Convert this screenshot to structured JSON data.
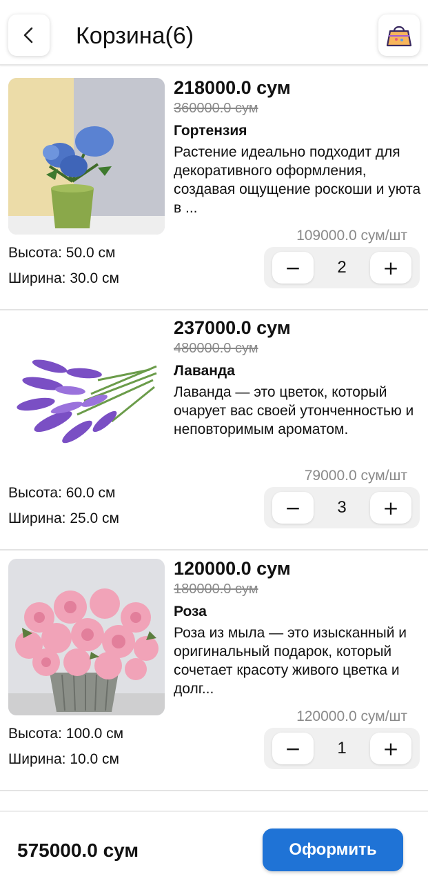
{
  "header": {
    "title": "Корзина(6)",
    "back_icon": "chevron-left-icon",
    "gift_icon": "gift-bag-icon"
  },
  "items": [
    {
      "price": "218000.0 сум",
      "old_price": "360000.0 сум",
      "name": "Гортензия",
      "description": "Растение идеально подходит для декоративного оформления, создавая ощущение роскоши и уюта в ...",
      "unit_price": "109000.0 сум/шт",
      "height": "Высота: 50.0 см",
      "width": "Ширина: 30.0 см",
      "quantity": "2",
      "minus": "−",
      "plus": "+"
    },
    {
      "price": "237000.0 сум",
      "old_price": "480000.0 сум",
      "name": "Лаванда",
      "description": "Лаванда — это цветок, который очарует вас своей утонченностью и неповторимым ароматом.",
      "unit_price": "79000.0 сум/шт",
      "height": "Высота: 60.0 см",
      "width": "Ширина: 25.0 см",
      "quantity": "3",
      "minus": "−",
      "plus": "+"
    },
    {
      "price": "120000.0 сум",
      "old_price": "180000.0 сум",
      "name": "Роза",
      "description": "Роза из мыла — это изысканный и оригинальный подарок, который сочетает красоту живого цветка и долг...",
      "unit_price": "120000.0 сум/шт",
      "height": "Высота: 100.0 см",
      "width": "Ширина: 10.0 см",
      "quantity": "1",
      "minus": "−",
      "plus": "+"
    }
  ],
  "footer": {
    "total": "575000.0 сум",
    "checkout_label": "Оформить"
  },
  "colors": {
    "accent": "#1f73d6",
    "muted_text": "#8a8a8a",
    "stepper_bg": "#f0f0f0"
  }
}
